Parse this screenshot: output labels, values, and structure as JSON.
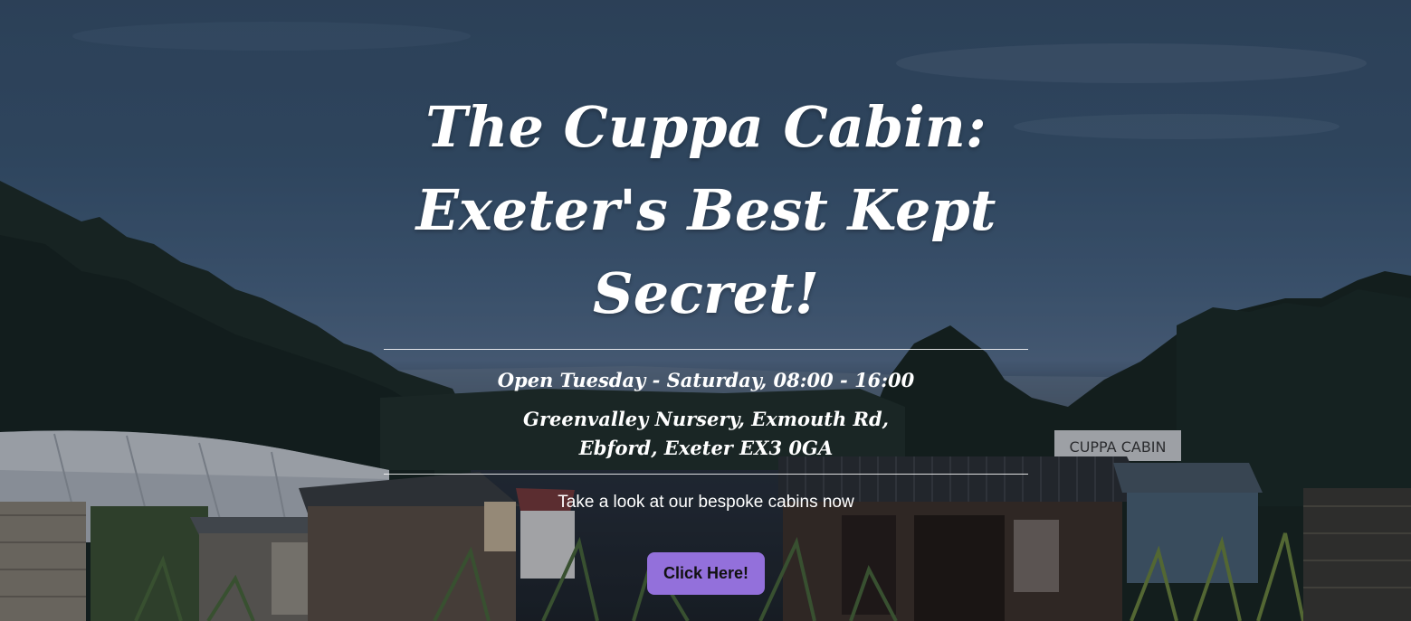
{
  "hero": {
    "title_line1": "The Cuppa Cabin:",
    "title_line2": "Exeter's Best Kept Secret!",
    "hours": "Open Tuesday - Saturday, 08:00 - 16:00",
    "address_line1": "Greenvalley Nursery, Exmouth Rd,",
    "address_line2": "Ebford, Exeter EX3 0GA",
    "tagline": "Take a look at our bespoke cabins now",
    "cta_label": "Click Here!",
    "sign_text": "CUPPA CABIN"
  },
  "colors": {
    "cta_background": "#9370db",
    "text": "#ffffff",
    "sky": "#3c5a78"
  }
}
